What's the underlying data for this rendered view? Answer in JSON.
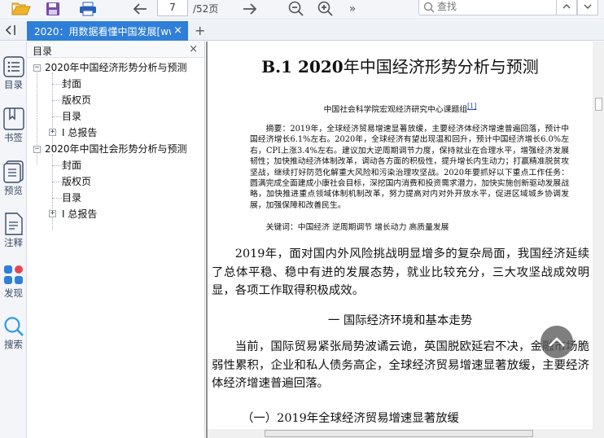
{
  "toolbar": {
    "page_current": "7",
    "page_total": "/52页",
    "search_placeholder": "查找"
  },
  "tab": {
    "title": "2020：用数据看懂中国发展[ww",
    "close": "×",
    "add": "+"
  },
  "rail": {
    "items": [
      {
        "label": "目录",
        "icon": "toc-icon"
      },
      {
        "label": "书签",
        "icon": "bookmark-icon"
      },
      {
        "label": "预览",
        "icon": "preview-icon"
      },
      {
        "label": "注释",
        "icon": "annotation-icon"
      },
      {
        "label": "发现",
        "icon": "discover-icon"
      },
      {
        "label": "搜索",
        "icon": "search-icon"
      }
    ]
  },
  "outline": {
    "title": "目录",
    "close": "×",
    "nodes": [
      {
        "label": "2020年中国经济形势分析与预测",
        "expander": "−"
      },
      {
        "label": "封面"
      },
      {
        "label": "版权页"
      },
      {
        "label": "目录"
      },
      {
        "label": "Ⅰ 总报告",
        "expander": "+"
      },
      {
        "label": "2020年中国社会形势分析与预测",
        "expander": "−"
      },
      {
        "label": "封面"
      },
      {
        "label": "版权页"
      },
      {
        "label": "目录"
      },
      {
        "label": "Ⅰ 总报告",
        "expander": "+"
      }
    ]
  },
  "document": {
    "title_bold": "B.1 2020",
    "title_rest": "年中国经济形势分析与预测",
    "author": "中国社会科学院宏观经济研究中心课题组",
    "footnote_ref": "[1]",
    "abstract": "摘要：2019年，全球经济贸易增速显著放缓，主要经济体经济增速普遍回落，预计中国经济增长6.1%左右。2020年，全球经济有望出现温和回升，预计中国经济增长6.0%左右，CPI上涨3.4%左右。建议加大逆周期调节力度，保持就业在合理水平，增强经济发展韧性；加快推动经济体制改革，调动各方面的积极性，提升增长内生动力；打赢精准脱贫攻坚战，继续打好防范化解重大风险和污染治理攻坚战。2020年要抓好以下重点工作任务：圆满完成全面建成小康社会目标，深挖国内消费和投资需求潜力，加快实施创新驱动发展战略，加快推进重点领域体制机制改革，努力提高对内对外开放水平，促进区域城乡协调发展，加强保障和改善民生。",
    "keywords": "关键词：中国经济 逆周期调节 增长动力 高质量发展",
    "para1": "2019年，面对国内外风险挑战明显增多的复杂局面，我国经济延续了总体平稳、稳中有进的发展态势，就业比较充分，三大攻坚战成效明显，各项工作取得积极成效。",
    "section1": "一 国际经济环境和基本走势",
    "para2": "当前，国际贸易紧张局势波谲云诡，英国脱欧延宕不决，金融市场脆弱性累积，企业和私人债务高企，全球经济贸易增速显著放缓，主要经济体经济增速普遍回落。",
    "subsection1": "（一）2019年全球经济贸易增速显著放缓"
  },
  "colors": {
    "accent": "#2f7fd8",
    "rail_text": "#3a4a66",
    "doc_bg": "#8e8e8e"
  }
}
